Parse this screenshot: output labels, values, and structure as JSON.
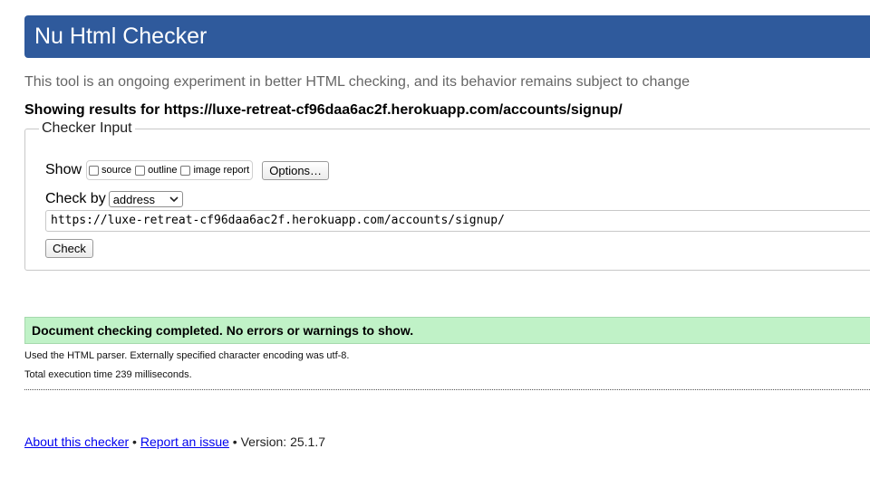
{
  "header": {
    "title": "Nu Html Checker"
  },
  "intro": {
    "subtitle": "This tool is an ongoing experiment in better HTML checking, and its behavior remains subject to change",
    "showing_results": "Showing results for https://luxe-retreat-cf96daa6ac2f.herokuapp.com/accounts/signup/"
  },
  "checker_input": {
    "legend": "Checker Input",
    "show_label": "Show",
    "show_options": [
      {
        "label": "source",
        "checked": false
      },
      {
        "label": "outline",
        "checked": false
      },
      {
        "label": "image report",
        "checked": false
      }
    ],
    "options_button": "Options…",
    "check_by_label": "Check by",
    "check_by_selected": "address",
    "url_value": "https://luxe-retreat-cf96daa6ac2f.herokuapp.com/accounts/signup/",
    "check_button": "Check"
  },
  "results": {
    "success_message": "Document checking completed. No errors or warnings to show.",
    "parser_note": "Used the HTML parser. Externally specified character encoding was utf-8.",
    "execution_time": "Total execution time 239 milliseconds."
  },
  "footer": {
    "about_link": "About this checker",
    "separator": " • ",
    "report_link": "Report an issue",
    "version": " • Version: 25.1.7"
  },
  "colors": {
    "title_bar": "#2f5a9c",
    "success_background": "#c0f2c7",
    "link": "#0000ee"
  }
}
